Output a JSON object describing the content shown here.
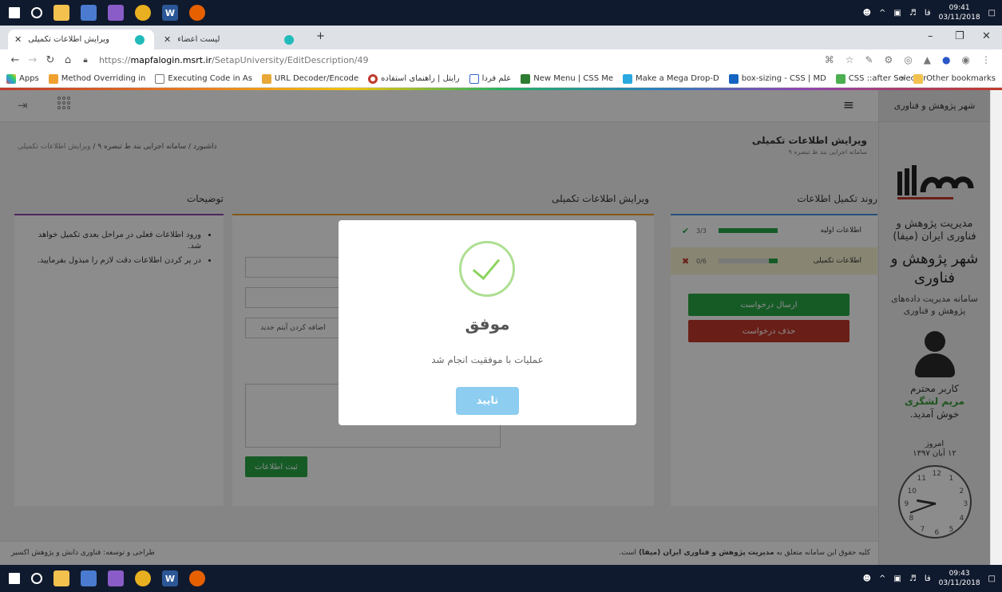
{
  "taskbar": {
    "time_top": "09:41",
    "date_top": "03/11/2018",
    "time_bottom": "09:43",
    "date_bottom": "03/11/2018",
    "lang": "فا"
  },
  "browser": {
    "tabs": [
      {
        "title": "ویرایش اطلاعات تکمیلی",
        "active": true
      },
      {
        "title": "لیست اعضاء",
        "active": false
      }
    ],
    "url_protocol": "https://",
    "url_host": "mapfalogin.msrt.ir",
    "url_path": "/SetapUniversity/EditDescription/49",
    "bookmarks": [
      {
        "label": "Apps",
        "icon": "apps-grid-icon"
      },
      {
        "label": "Method Overriding in",
        "icon": "java-icon"
      },
      {
        "label": "Executing Code in As",
        "icon": "page-icon"
      },
      {
        "label": "URL Decoder/Encode",
        "icon": "tool-icon"
      },
      {
        "label": "رایتل | راهنمای استفاده",
        "icon": "opera-icon"
      },
      {
        "label": "علم فردا",
        "icon": "e-icon"
      },
      {
        "label": "New Menu | CSS Me",
        "icon": "menu-icon"
      },
      {
        "label": "Make a Mega Drop-D",
        "icon": "arrow-icon"
      },
      {
        "label": "box-sizing - CSS | MD",
        "icon": "mdn-icon"
      },
      {
        "label": "CSS ::after Selector",
        "icon": "w3-icon"
      }
    ],
    "other_bookmarks": "Other bookmarks"
  },
  "sidebar": {
    "title": "شهر پژوهش و فناوری",
    "org_name": "مدیریت پژوهش و فناوری ایران (میفا)",
    "city_name": "شهر پژوهش و فناوری",
    "system_name": "سامانه مدیریت داده‌های پژوهش و فناوری",
    "greeting_prefix": "کاربر محترم",
    "user_name": "مریم لشگری",
    "greeting_suffix": "خوش آمدید.",
    "today_label": "امروز",
    "today_date": "۱۲ آبان ۱۳۹۷"
  },
  "page": {
    "title": "ویرایش اطلاعات تکمیلی",
    "subtitle": "سامانه اجرایی بند ط تبصره ۹",
    "breadcrumb": [
      "داشبورد",
      "سامانه اجرایی بند ط تبصره ۹",
      "ویرایش اطلاعات تکمیلی"
    ]
  },
  "progress_panel": {
    "title": "روند تکمیل اطلاعات",
    "steps": [
      {
        "label": "اطلاعات اولیه",
        "count": "3/3",
        "progress": 1.0,
        "status": "✔"
      },
      {
        "label": "اطلاعات تکمیلی",
        "count": "0/6",
        "progress": 0.15,
        "status": "✖"
      }
    ],
    "send_button": "ارسال درخواست",
    "delete_button": "حذف درخواست"
  },
  "edit_panel": {
    "title": "ویرایش اطلاعات تکمیلی",
    "add_item_button": "اضافه کردن آیتم جدید",
    "submit_button": "ثبت اطلاعات"
  },
  "notes_panel": {
    "title": "توضیحات",
    "items": [
      "ورود اطلاعات فعلی در مراحل بعدی تکمیل خواهد شد.",
      "در پر کردن اطلاعات دقت لازم را مبذول بفرمایید."
    ]
  },
  "footer": {
    "rights_prefix": "کلیه حقوق این سامانه متعلق به",
    "rights_org": "مدیریت پژوهش و فناوری ایران (میفا)",
    "rights_suffix": "است.",
    "design": "طراحی و توسعه: فناوری دانش و پژوهش اکسیر"
  },
  "modal": {
    "title": "موفق",
    "message": "عملیات با موفقیت انجام شد",
    "confirm_button": "تایید"
  },
  "colors": {
    "green": "#28a745",
    "red": "#c0392b",
    "modal_button": "#8ccdf0",
    "success_check": "#8cd45e"
  }
}
